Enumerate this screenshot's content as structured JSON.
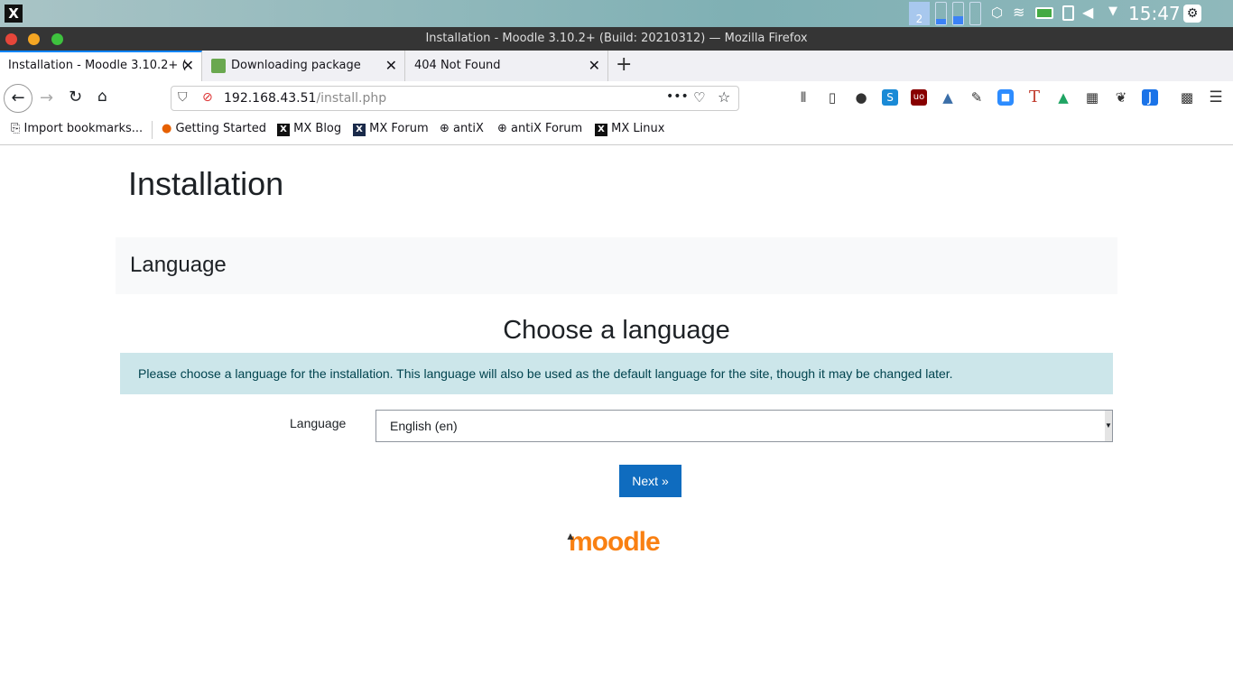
{
  "taskbar": {
    "workspace": "2",
    "clock": "15:47"
  },
  "window": {
    "title": "Installation - Moodle 3.10.2+ (Build: 20210312) — Mozilla Firefox"
  },
  "tabs": [
    {
      "label": "Installation - Moodle 3.10.2+ (",
      "active": true
    },
    {
      "label": "Downloading package"
    },
    {
      "label": "404 Not Found"
    }
  ],
  "url": {
    "host": "192.168.43.51",
    "path": "/install.php"
  },
  "bookmarks": [
    "Import bookmarks...",
    "Getting Started",
    "MX Blog",
    "MX Forum",
    "antiX",
    "antiX Forum",
    "MX Linux"
  ],
  "page": {
    "title": "Installation",
    "section": "Language",
    "heading": "Choose a language",
    "info": "Please choose a language for the installation. This language will also be used as the default language for the site, though it may be changed later.",
    "language_label": "Language",
    "language_value": "English (en)",
    "next": "Next »",
    "logo": "moodle"
  },
  "colors": {
    "accent": "#0f6cbf",
    "alert_bg": "#cce6ea",
    "logo": "#f98012"
  }
}
